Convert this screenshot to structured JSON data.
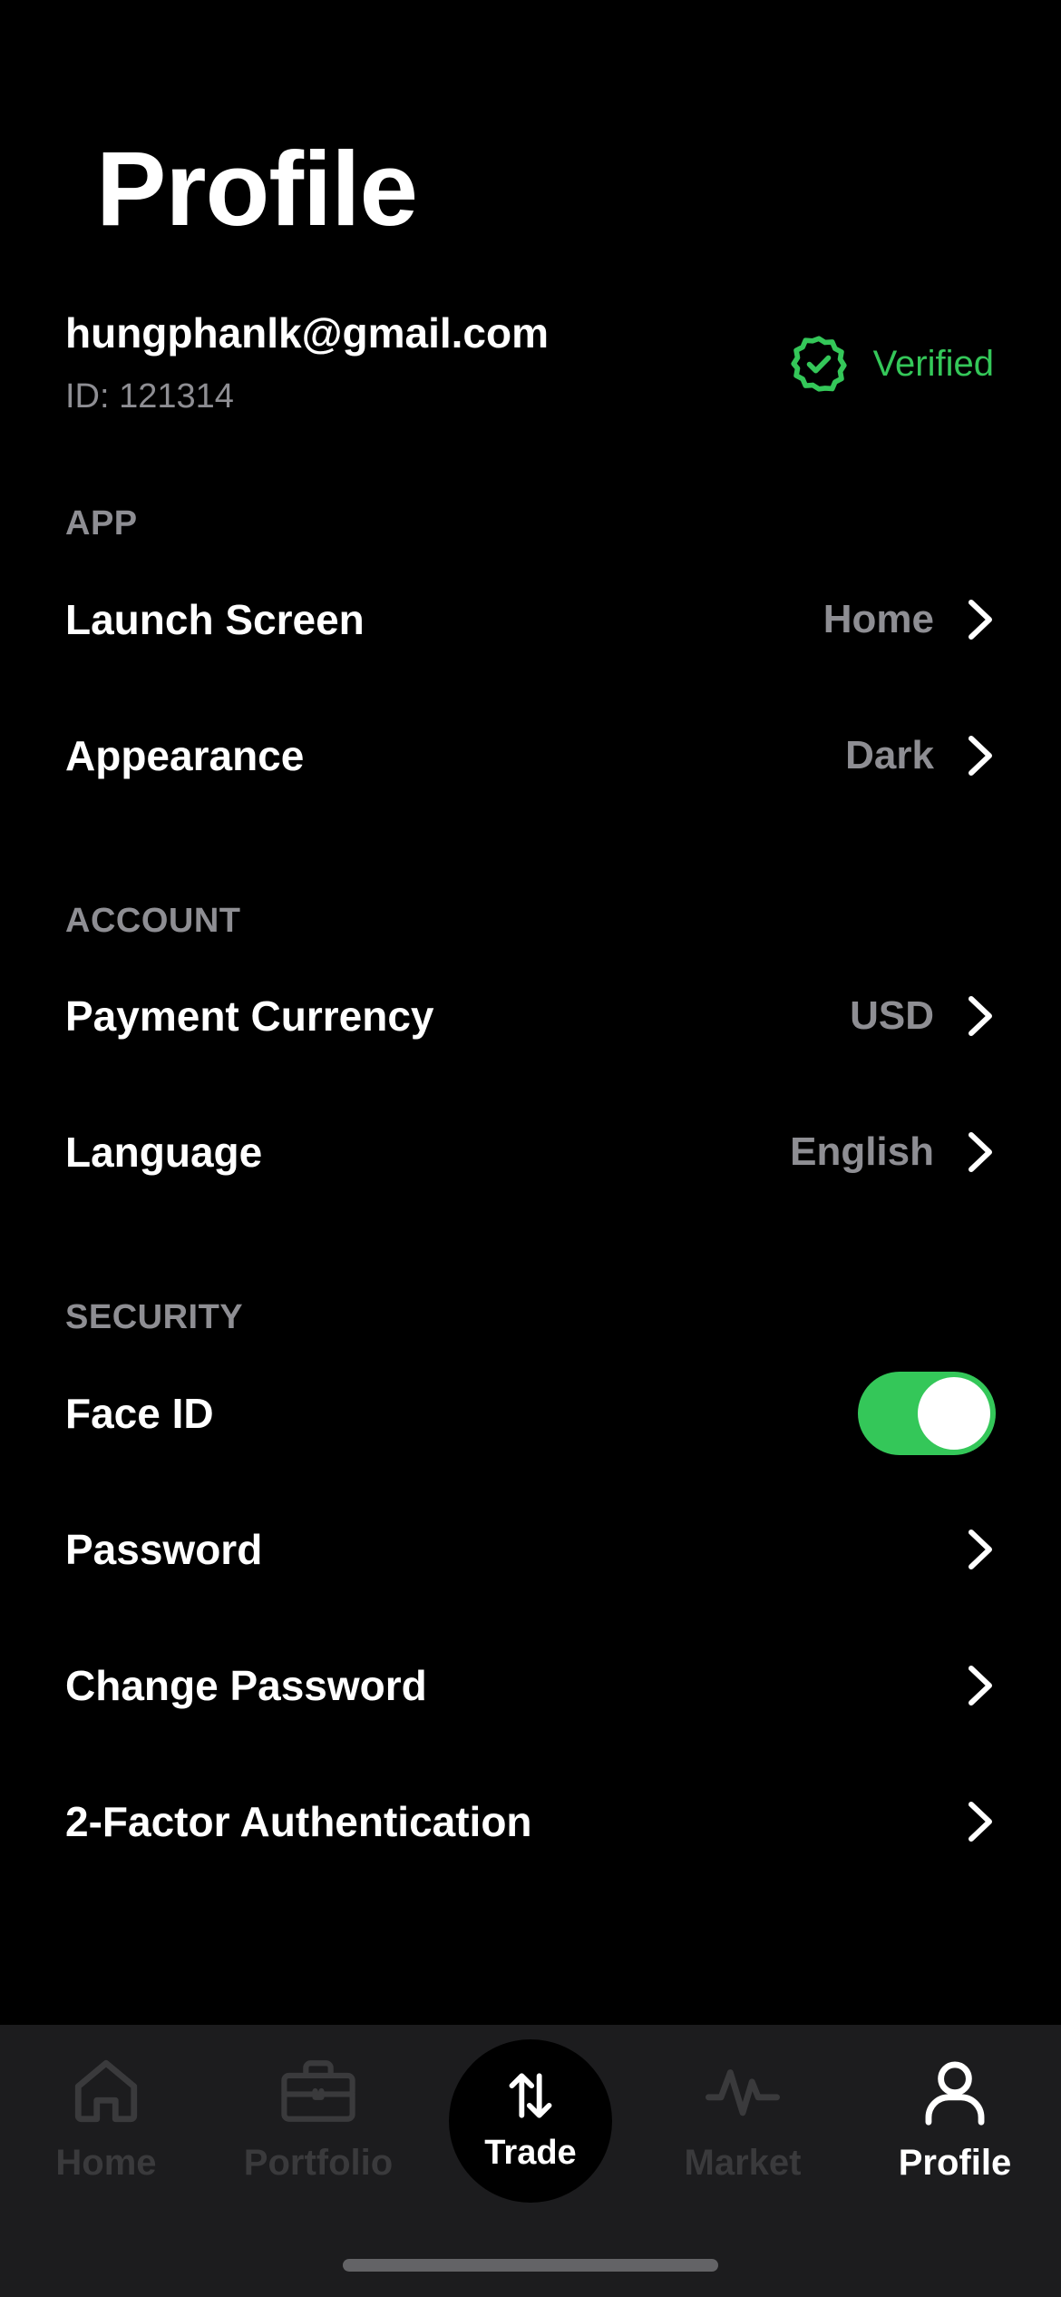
{
  "page": {
    "title": "Profile"
  },
  "user": {
    "email": "hungphanlk@gmail.com",
    "id_text": "ID: 121314",
    "verified_label": "Verified",
    "verified_icon": "badge-check-icon",
    "verified_color": "#34c759"
  },
  "sections": {
    "app": {
      "header": "APP",
      "items": [
        {
          "label": "Launch Screen",
          "value": "Home"
        },
        {
          "label": "Appearance",
          "value": "Dark"
        }
      ]
    },
    "account": {
      "header": "ACCOUNT",
      "items": [
        {
          "label": "Payment Currency",
          "value": "USD"
        },
        {
          "label": "Language",
          "value": "English"
        }
      ]
    },
    "security": {
      "header": "SECURITY",
      "face_id": {
        "label": "Face ID",
        "enabled": true
      },
      "items": [
        {
          "label": "Password"
        },
        {
          "label": "Change Password"
        },
        {
          "label": "2-Factor Authentication"
        }
      ]
    }
  },
  "tab_bar": {
    "tabs": [
      {
        "label": "Home",
        "icon": "home-icon",
        "active": false
      },
      {
        "label": "Portfolio",
        "icon": "briefcase-icon",
        "active": false
      },
      {
        "label": "Trade",
        "icon": "swap-arrows-icon",
        "active": false
      },
      {
        "label": "Market",
        "icon": "activity-icon",
        "active": false
      },
      {
        "label": "Profile",
        "icon": "user-icon",
        "active": true
      }
    ]
  },
  "colors": {
    "background": "#000000",
    "accent": "#34c759",
    "secondary_text": "#8e8e93",
    "tab_bar_bg": "#1c1c1e",
    "inactive_tab": "#3a3a3c"
  }
}
